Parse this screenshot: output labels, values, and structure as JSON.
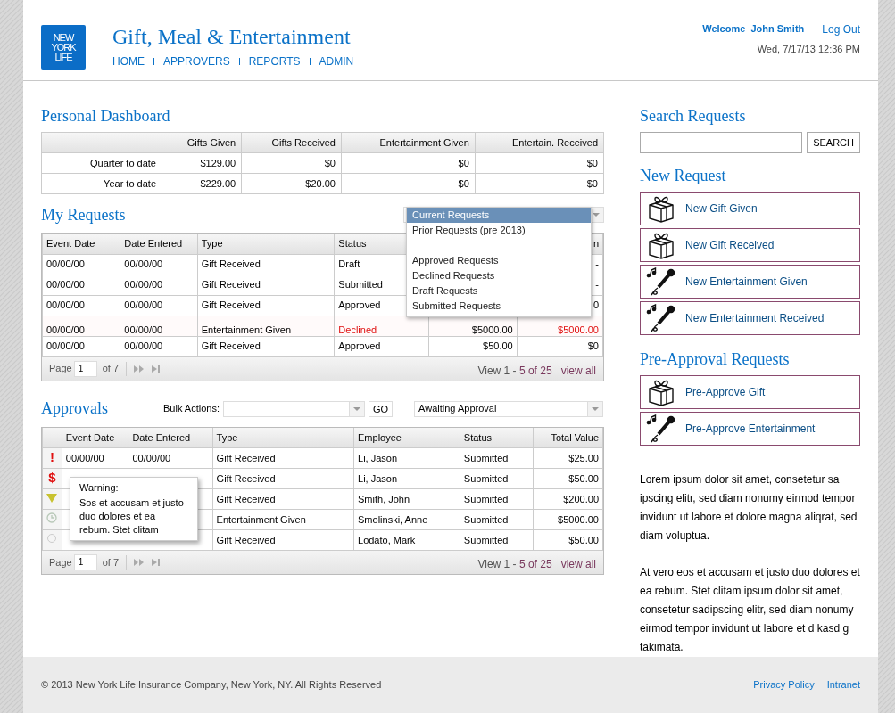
{
  "header": {
    "logo": [
      "NEW",
      "YORK",
      "LIFE"
    ],
    "title": "Gift, Meal & Entertainment",
    "nav": [
      "HOME",
      "APPROVERS",
      "REPORTS",
      "ADMIN"
    ],
    "welcome": "Welcome  John Smith",
    "logout": "Log Out",
    "datetime": "Wed, 7/17/13 12:36 PM"
  },
  "dashboard": {
    "title": "Personal Dashboard",
    "columns": [
      "",
      "Gifts Given",
      "Gifts Received",
      "Entertainment Given",
      "Entertain. Received"
    ],
    "rows": [
      [
        "Quarter to date",
        "$129.00",
        "$0",
        "$0",
        "$0"
      ],
      [
        "Year to date",
        "$229.00",
        "$20.00",
        "$0",
        "$0"
      ]
    ]
  },
  "my_requests": {
    "title": "My Requests",
    "columns": [
      "Event Date",
      "Date Entered",
      "Type",
      "Status",
      "",
      "n"
    ],
    "rows": [
      {
        "cells": [
          "00/00/00",
          "00/00/00",
          "Gift Received",
          "Draft",
          "",
          "-"
        ],
        "declined": false
      },
      {
        "cells": [
          "00/00/00",
          "00/00/00",
          "Gift Received",
          "Submitted",
          "",
          "-"
        ],
        "declined": false
      },
      {
        "cells": [
          "00/00/00",
          "00/00/00",
          "Gift Received",
          "Approved",
          "",
          "0"
        ],
        "declined": false
      },
      {
        "cells": [
          "00/00/00",
          "00/00/00",
          "Entertainment Given",
          "Declined",
          "$5000.00",
          "$5000.00"
        ],
        "declined": true
      },
      {
        "cells": [
          "00/00/00",
          "00/00/00",
          "Gift Received",
          "Approved",
          "$50.00",
          "$0"
        ],
        "declined": false
      }
    ],
    "filter_options": [
      {
        "kind": "option",
        "label": "Current Requests",
        "selected": true
      },
      {
        "kind": "option",
        "label": "Prior Requests (pre 2013)",
        "selected": false
      },
      {
        "kind": "spacer"
      },
      {
        "kind": "option",
        "label": "Approved Requests",
        "selected": false
      },
      {
        "kind": "option",
        "label": "Declined Requests",
        "selected": false
      },
      {
        "kind": "option",
        "label": "Draft Requests",
        "selected": false
      },
      {
        "kind": "option",
        "label": "Submitted Requests",
        "selected": false
      }
    ],
    "pager": {
      "page_label": "Page",
      "page": "1",
      "of": "of 7",
      "view": "View 1 - ",
      "range": "5 of 25",
      "view_all": "view all"
    }
  },
  "approvals": {
    "title": "Approvals",
    "bulk_label": "Bulk Actions:",
    "go": "GO",
    "filter": "Awaiting Approval",
    "columns": [
      "",
      "Event Date",
      "Date Entered",
      "Type",
      "Employee",
      "Status",
      "Total Value"
    ],
    "rows": [
      {
        "kind": "urgent",
        "cells": [
          "!",
          "00/00/00",
          "00/00/00",
          "Gift Received",
          "Li, Jason",
          "Submitted",
          "$25.00"
        ]
      },
      {
        "kind": "money",
        "cells": [
          "$",
          "",
          "",
          "Gift Received",
          "Li, Jason",
          "Submitted",
          "$50.00"
        ]
      },
      {
        "kind": "warning",
        "cells": [
          "",
          "",
          "",
          "Gift Received",
          "Smith, John",
          "Submitted",
          "$200.00"
        ]
      },
      {
        "kind": "pending",
        "cells": [
          "",
          "",
          "",
          "Entertainment Given",
          "Smolinski, Anne",
          "Submitted",
          "$5000.00"
        ]
      },
      {
        "kind": "none",
        "cells": [
          "",
          "",
          "",
          "Gift Received",
          "Lodato, Mark",
          "Submitted",
          "$50.00"
        ]
      }
    ],
    "tooltip": {
      "title": "Warning:",
      "text": "Sos et accusam et justo duo dolores et ea rebum. Stet clitam"
    },
    "pager": {
      "page_label": "Page",
      "page": "1",
      "of": "of 7",
      "view": "View 1 - ",
      "range": "5 of 25",
      "view_all": "view all"
    }
  },
  "search": {
    "title": "Search Requests",
    "button": "SEARCH"
  },
  "new_request": {
    "title": "New Request",
    "items": [
      {
        "kind": "gift",
        "label": "New Gift Given"
      },
      {
        "kind": "gift",
        "label": "New Gift Received"
      },
      {
        "kind": "entertainment",
        "label": "New Entertainment Given"
      },
      {
        "kind": "entertainment",
        "label": "New Entertainment Received"
      }
    ]
  },
  "pre_approval": {
    "title": "Pre-Approval Requests",
    "items": [
      {
        "kind": "gift",
        "label": "Pre-Approve Gift"
      },
      {
        "kind": "entertainment",
        "label": "Pre-Approve Entertainment"
      }
    ]
  },
  "info": [
    "Lorem ipsum dolor sit amet, consetetur sa ipscing elitr, sed diam nonumy eirmod tempor invidunt ut labore et dolore magna aliqrat, sed diam voluptua.",
    "At vero eos et accusam et justo duo dolores et ea rebum. Stet clitam ipsum dolor sit amet, consetetur sadipscing elitr, sed diam nonumy eirmod tempor invidunt ut labore et d kasd g takimata."
  ],
  "footer": {
    "copyright": "© 2013 New York Life Insurance Company, New York, NY. All Rights Reserved",
    "links": [
      "Privacy Policy",
      "Intranet"
    ]
  }
}
